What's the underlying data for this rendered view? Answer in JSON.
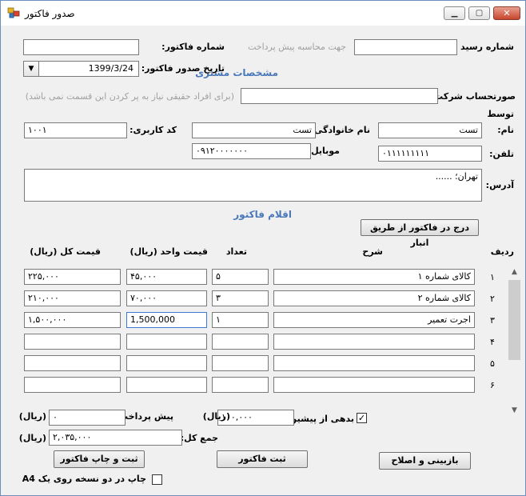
{
  "window": {
    "title": "صدور فاکتور"
  },
  "header": {
    "receipt_no_label": "شماره رسید :",
    "receipt_no_value": "",
    "prepay_calc_label": "جهت محاسبه پیش پرداخت",
    "invoice_no_label": "شماره فاکتور:",
    "invoice_no_value": "",
    "invoice_date_label": "تاریخ صدور فاکتور:",
    "invoice_date_value": "1399/3/24"
  },
  "customer": {
    "section_title": "مشخصات مشتری",
    "company_label": "صورتحساب شرکت:",
    "company_value": "",
    "company_hint": "(برای افراد حقیقی نیاز به پر کردن این قسمت نمی باشد)",
    "by_label": "توسط",
    "first_name_label": "نام:",
    "first_name_value": "تست",
    "last_name_label": "نام خانوادگی:",
    "last_name_value": "تست",
    "user_code_label": "کد کاربری:",
    "user_code_value": "۱۰۰۱",
    "phone_label": "تلفن:",
    "phone_value": "۰۱۱۱۱۱۱۱۱۱",
    "mobile_label": "موبایل:",
    "mobile_value": "۰۹۱۲۰۰۰۰۰۰۰",
    "address_label": "آدرس:",
    "address_value": "تهران؛ ......"
  },
  "items": {
    "section_title": "اقلام فاکتور",
    "insert_from_warehouse_button": "درج در فاکتور از طریق انبار",
    "columns": {
      "row": "ردیف",
      "description": "شرح",
      "quantity": "تعداد",
      "unit_price": "قیمت واحد (ریال)",
      "total_price": "قیمت کل (ریال)"
    },
    "rows": [
      {
        "num": "۱",
        "description": "کالای شماره ۱",
        "quantity": "۵",
        "unit_price": "۴۵,۰۰۰",
        "total_price": "۲۲۵,۰۰۰"
      },
      {
        "num": "۲",
        "description": "کالای شماره ۲",
        "quantity": "۳",
        "unit_price": "۷۰,۰۰۰",
        "total_price": "۲۱۰,۰۰۰"
      },
      {
        "num": "۳",
        "description": "اجرت تعمیر",
        "quantity": "۱",
        "unit_price": "1,500,000",
        "total_price": "۱,۵۰۰,۰۰۰"
      },
      {
        "num": "۴",
        "description": "",
        "quantity": "",
        "unit_price": "",
        "total_price": ""
      },
      {
        "num": "۵",
        "description": "",
        "quantity": "",
        "unit_price": "",
        "total_price": ""
      },
      {
        "num": "۶",
        "description": "",
        "quantity": "",
        "unit_price": "",
        "total_price": ""
      }
    ]
  },
  "totals": {
    "previous_debt_label": "بدهی از پیشین",
    "previous_debt_checked": true,
    "previous_debt_value": "۱۰۰,۰۰۰",
    "rial_unit": "(ریال)",
    "prepayment_label": "پیش پرداخت:",
    "prepayment_value": "۰",
    "sum_label": "جمع کل:",
    "sum_value": "۲,۰۳۵,۰۰۰"
  },
  "actions": {
    "review_edit_button": "بازبینی و اصلاح",
    "save_invoice_button": "ثبت فاکتور",
    "save_print_button": "ثبت و چاپ فاکتور",
    "two_copies_label": "چاپ در دو نسخه روی یک A4",
    "two_copies_checked": false
  }
}
